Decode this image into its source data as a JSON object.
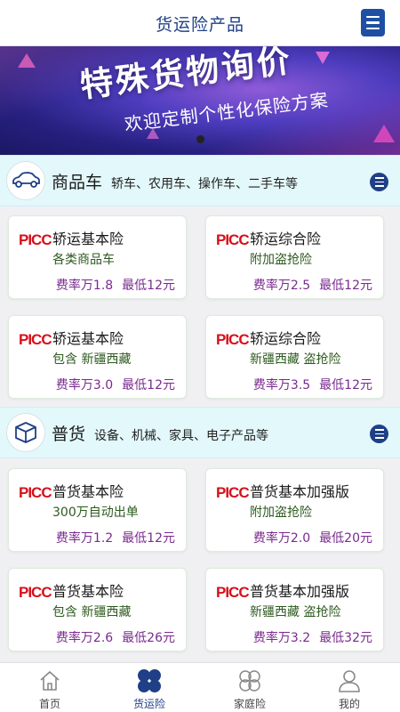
{
  "header": {
    "title": "货运险产品"
  },
  "banner": {
    "headline": "特殊货物询价",
    "subline": "欢迎定制个性化保险方案"
  },
  "categories": [
    {
      "name": "商品车",
      "desc": "轿车、农用车、操作车、二手车等",
      "icon": "car-icon",
      "products": [
        {
          "logo": "PICC",
          "name": "轿运基本险",
          "sub": "各类商品车",
          "rate": "费率万1.8",
          "min": "最低12元"
        },
        {
          "logo": "PICC",
          "name": "轿运综合险",
          "sub": "附加盗抢险",
          "rate": "费率万2.5",
          "min": "最低12元"
        },
        {
          "logo": "PICC",
          "name": "轿运基本险",
          "sub": "包含 新疆西藏",
          "rate": "费率万3.0",
          "min": "最低12元"
        },
        {
          "logo": "PICC",
          "name": "轿运综合险",
          "sub": "新疆西藏 盗抢险",
          "rate": "费率万3.5",
          "min": "最低12元"
        }
      ]
    },
    {
      "name": "普货",
      "desc": "设备、机械、家具、电子产品等",
      "icon": "box-icon",
      "products": [
        {
          "logo": "PICC",
          "name": "普货基本险",
          "sub": "300万自动出单",
          "rate": "费率万1.2",
          "min": "最低12元"
        },
        {
          "logo": "PICC",
          "name": "普货基本加强版",
          "sub": "附加盗抢险",
          "rate": "费率万2.0",
          "min": "最低20元"
        },
        {
          "logo": "PICC",
          "name": "普货基本险",
          "sub": "包含 新疆西藏",
          "rate": "费率万2.6",
          "min": "最低26元"
        },
        {
          "logo": "PICC",
          "name": "普货基本加强版",
          "sub": "新疆西藏 盗抢险",
          "rate": "费率万3.2",
          "min": "最低32元"
        }
      ]
    }
  ],
  "nav": [
    {
      "label": "首页",
      "icon": "home-icon",
      "active": false
    },
    {
      "label": "货运险",
      "icon": "clover-icon",
      "active": true
    },
    {
      "label": "家庭险",
      "icon": "clover-outline-icon",
      "active": false
    },
    {
      "label": "我的",
      "icon": "user-icon",
      "active": false
    }
  ],
  "colors": {
    "brand": "#1f3f86",
    "picc_red": "#d7101a",
    "rate_purple": "#7a2a8f",
    "sub_green": "#2d5a1f",
    "category_bg": "#e3f8fb"
  }
}
